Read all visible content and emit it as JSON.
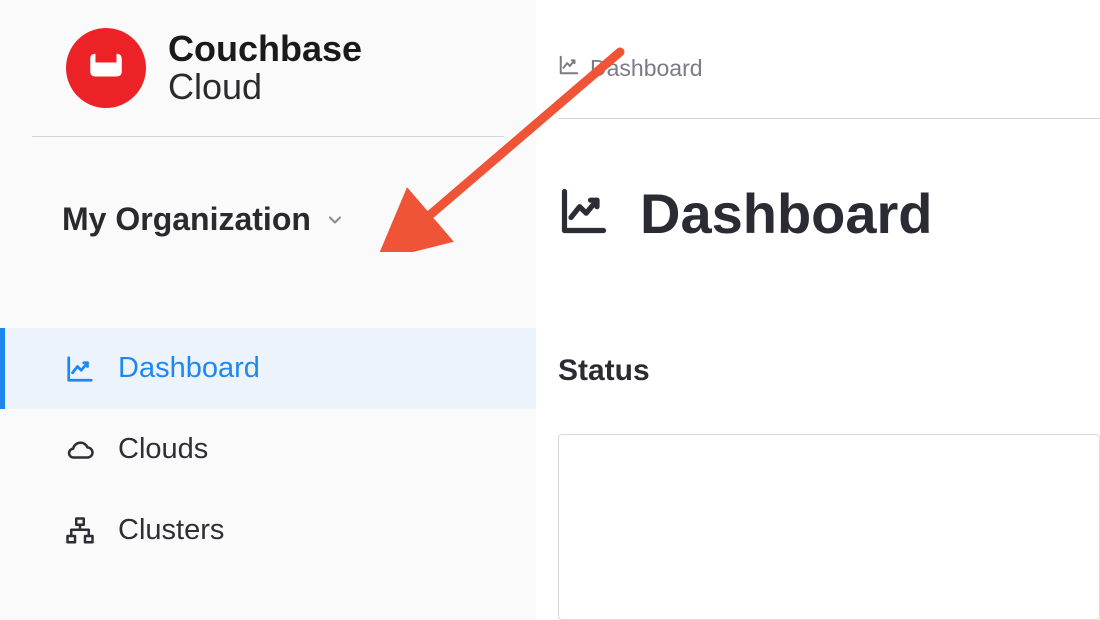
{
  "brand": {
    "title": "Couchbase",
    "subtitle": "Cloud"
  },
  "sidebar": {
    "org_label": "My Organization",
    "items": [
      {
        "label": "Dashboard",
        "icon": "chart-line-icon",
        "active": true
      },
      {
        "label": "Clouds",
        "icon": "cloud-icon",
        "active": false
      },
      {
        "label": "Clusters",
        "icon": "cluster-icon",
        "active": false
      }
    ]
  },
  "breadcrumb": {
    "label": "Dashboard"
  },
  "page": {
    "title": "Dashboard",
    "status_heading": "Status"
  }
}
